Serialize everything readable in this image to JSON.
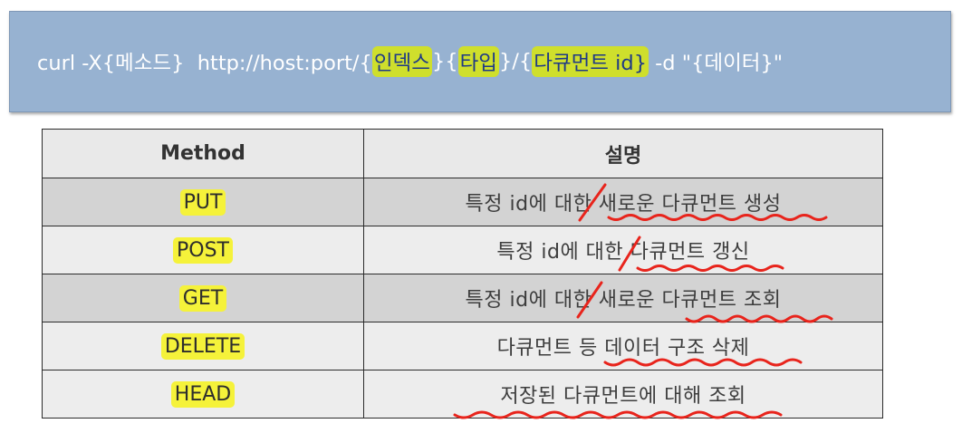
{
  "curl": {
    "prefix": "curl -X{메소드}  http://host:port/{",
    "index": "인덱스",
    "sep1": "}{",
    "type": "타입",
    "sep2": "}/{",
    "doc_id": "다큐먼트 id}",
    "suffix": " -d \"{데이터}\""
  },
  "table": {
    "headers": [
      "Method",
      "설명"
    ],
    "rows": [
      {
        "method": "PUT",
        "desc": "특정 id에 대한 새로운 다큐먼트 생성"
      },
      {
        "method": "POST",
        "desc": "특정 id에 대한 다큐먼트 갱신"
      },
      {
        "method": "GET",
        "desc": "특정 id에 대한 새로운 다큐먼트 조회"
      },
      {
        "method": "DELETE",
        "desc": "다큐먼트 등 데이터 구조 삭제"
      },
      {
        "method": "HEAD",
        "desc": "저장된 다큐먼트에 대해 조회"
      }
    ]
  },
  "colors": {
    "banner": "#97b2d1",
    "highlight": "#f5f23a",
    "annotation_red": "#e8241c"
  }
}
